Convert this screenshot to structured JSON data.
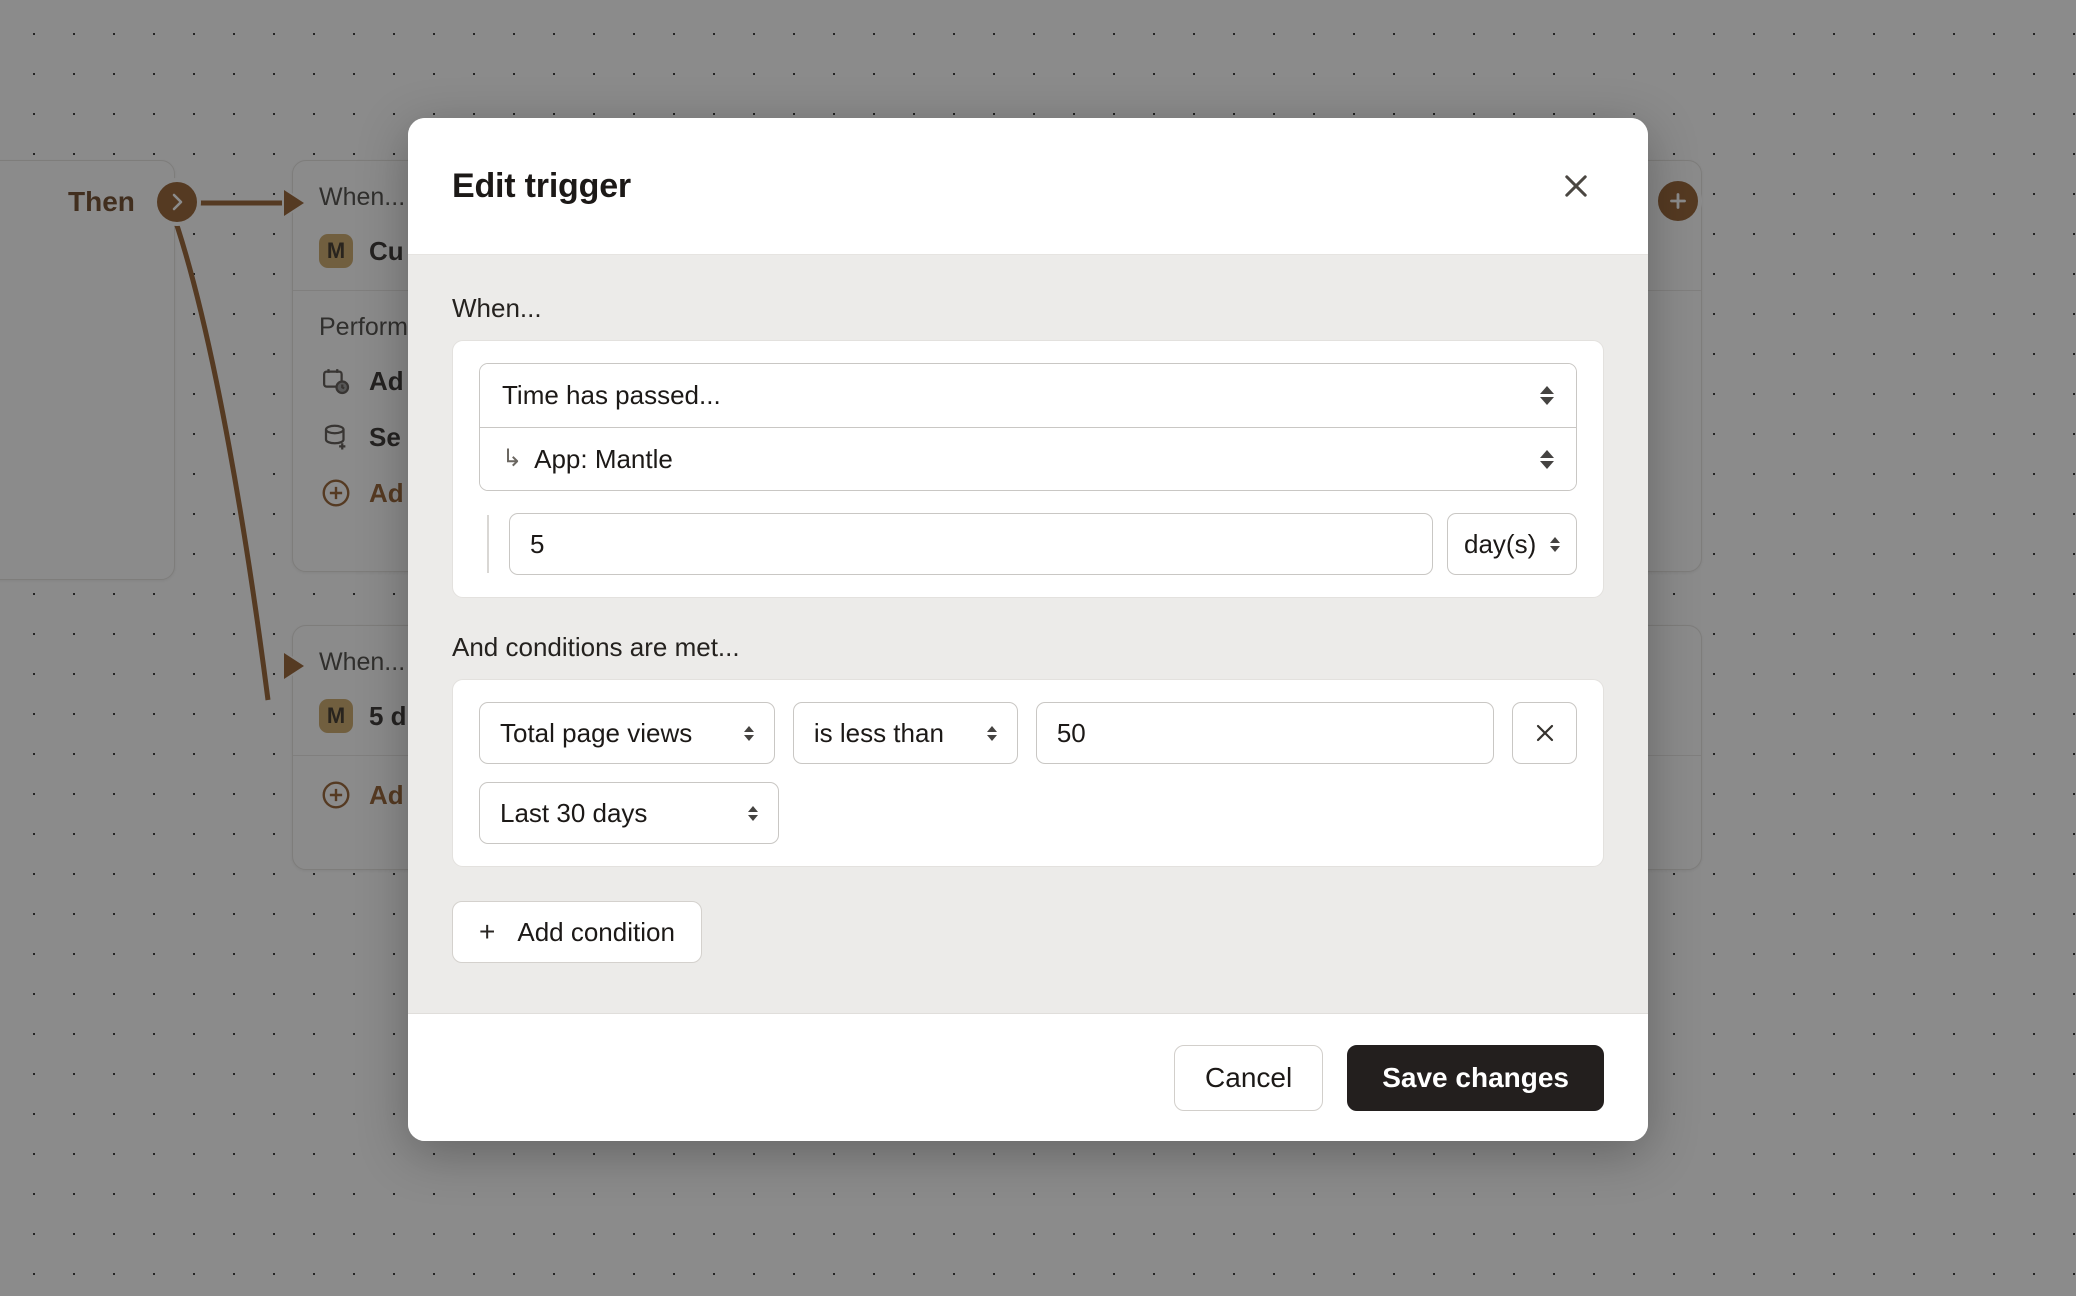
{
  "canvas": {
    "then_node": {
      "label": "Then",
      "chevron_icon": "chevron-right-icon"
    },
    "add_node_icon": "plus-icon",
    "cards": [
      {
        "title": "When...",
        "trigger": {
          "badge": "M",
          "text": "Cu"
        },
        "actions_title": "Perform...",
        "actions": [
          {
            "icon": "calendar-clock-icon",
            "text": "Ad"
          },
          {
            "icon": "database-plus-icon",
            "text": "Se"
          },
          {
            "icon": "plus-circle-icon",
            "text": "Ad",
            "link": true
          }
        ]
      },
      {
        "title": "When...",
        "trigger": {
          "badge": "M",
          "text": "5 d"
        },
        "actions": [
          {
            "icon": "plus-circle-icon",
            "text": "Ad",
            "link": true
          }
        ]
      }
    ]
  },
  "modal": {
    "title": "Edit trigger",
    "close_icon": "close-icon",
    "when": {
      "label": "When...",
      "trigger_select": {
        "value": "Time has passed...",
        "indicator_icon": "select-updown-icon"
      },
      "app_select": {
        "prefix_icon": "subtask-arrow-icon",
        "value": "App: Mantle",
        "indicator_icon": "select-updown-icon"
      },
      "duration": {
        "amount": "5",
        "amount_placeholder": "",
        "unit": "day(s)",
        "unit_indicator_icon": "select-updown-icon"
      }
    },
    "conditions": {
      "label": "And conditions are met...",
      "rows": [
        {
          "metric": "Total page views",
          "operator": "is less than",
          "value": "50",
          "value_placeholder": "",
          "timeframe": "Last 30 days",
          "remove_icon": "close-icon"
        }
      ],
      "add_button": {
        "icon": "plus-icon",
        "label": "Add condition"
      }
    },
    "footer": {
      "cancel_label": "Cancel",
      "save_label": "Save changes"
    }
  },
  "colors": {
    "accent_brown": "#8A4F1C",
    "badge_gold": "#C6A05A",
    "primary_button": "#231F1E",
    "modal_body": "#ECEBE9"
  }
}
